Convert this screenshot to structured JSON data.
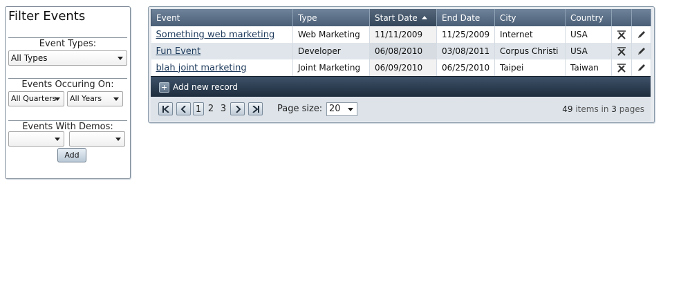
{
  "filter": {
    "title": "Filter Events",
    "event_types_label": "Event Types:",
    "event_types_value": "All Types",
    "occurring_label": "Events Occuring On:",
    "quarters_value": "All Quarters",
    "years_value": "All Years",
    "demos_label": "Events With Demos:",
    "demos_value_1": "",
    "demos_value_2": "",
    "add_label": "Add"
  },
  "grid": {
    "columns": [
      "Event",
      "Type",
      "Start Date",
      "End Date",
      "City",
      "Country",
      "",
      ""
    ],
    "sorted_column": "Start Date",
    "rows": [
      {
        "event": "Something web marketing",
        "type": "Web Marketing",
        "start": "11/11/2009",
        "end": "11/25/2009",
        "city": "Internet",
        "country": "USA"
      },
      {
        "event": "Fun Event",
        "type": "Developer",
        "start": "06/08/2010",
        "end": "03/08/2011",
        "city": "Corpus Christi",
        "country": "USA"
      },
      {
        "event": "blah joint marketing",
        "type": "Joint Marketing",
        "start": "06/09/2010",
        "end": "06/25/2010",
        "city": "Taipei",
        "country": "Taiwan"
      }
    ],
    "add_record_label": "Add new record"
  },
  "pager": {
    "pages": [
      "1",
      "2",
      "3"
    ],
    "current_page": "1",
    "page_size_label": "Page size:",
    "page_size_value": "20",
    "item_count": "49",
    "items_text": "items in",
    "page_count": "3",
    "pages_text": "pages"
  },
  "colors": {
    "header_gradient_top": "#6f839a",
    "header_gradient_bottom": "#4a5f76",
    "command_bar": "#2b3b4e",
    "link": "#1d3a5c",
    "alt_row": "#dfe5ea"
  },
  "icons": {
    "first": "first-page-icon",
    "prev": "prev-page-icon",
    "next": "next-page-icon",
    "last": "last-page-icon",
    "delete": "delete-icon",
    "edit": "edit-pencil-icon",
    "add": "plus-icon"
  }
}
